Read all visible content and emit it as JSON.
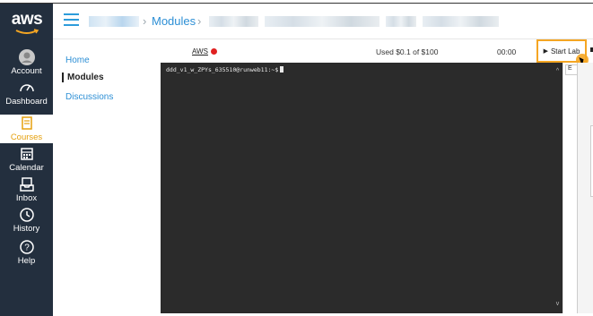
{
  "nav": {
    "logo": "aws",
    "items": [
      {
        "label": "Account",
        "icon": "user-avatar-icon"
      },
      {
        "label": "Dashboard",
        "icon": "speedometer-icon"
      },
      {
        "label": "Courses",
        "icon": "book-icon"
      },
      {
        "label": "Calendar",
        "icon": "calendar-icon"
      },
      {
        "label": "Inbox",
        "icon": "inbox-icon"
      },
      {
        "label": "History",
        "icon": "clock-icon"
      },
      {
        "label": "Help",
        "icon": "question-icon"
      }
    ],
    "active_color": "#e5a00d",
    "background": "#232f3e"
  },
  "breadcrumb": {
    "separator": "›",
    "modules": "Modules"
  },
  "course_nav": {
    "items": [
      "Home",
      "Modules",
      "Discussions"
    ],
    "active": "Modules"
  },
  "lab": {
    "tab_label": "AWS",
    "status_color": "#e02020",
    "budget": "Used $0.1 of $100",
    "timer": "00:00",
    "start_button": "Start Lab",
    "highlight_color": "#f5a623"
  },
  "terminal": {
    "prompt": "ddd_v1_w_ZPYs_635510@runweb11:~$"
  },
  "side_panel": {
    "label": "E"
  }
}
